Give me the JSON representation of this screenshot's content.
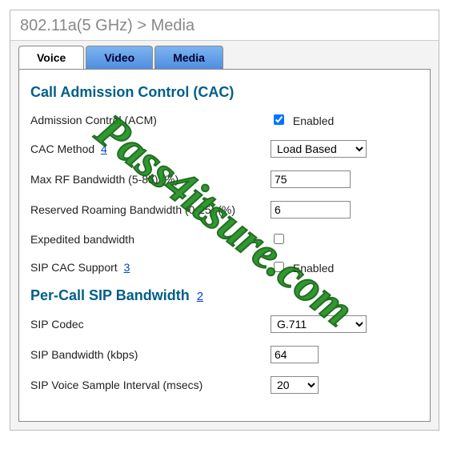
{
  "breadcrumb": "802.11a(5 GHz) > Media",
  "tabs": {
    "voice": "Voice",
    "video": "Video",
    "media": "Media"
  },
  "cac": {
    "heading": "Call Admission Control (CAC)",
    "acm_label": "Admission Control (ACM)",
    "acm_enabled_text": "Enabled",
    "acm_checked": true,
    "method_label": "CAC Method",
    "method_help": "4",
    "method_value": "Load Based",
    "maxrf_label": "Max RF Bandwidth (5-85) (%)",
    "maxrf_value": "75",
    "roaming_label": "Reserved Roaming Bandwidth (0-25) (%)",
    "roaming_value": "6",
    "expedited_label": "Expedited bandwidth",
    "expedited_checked": false,
    "sipcac_label": "SIP CAC Support",
    "sipcac_help": "3",
    "sipcac_enabled_text": "Enabled",
    "sipcac_checked": false
  },
  "percall": {
    "heading": "Per-Call SIP Bandwidth",
    "heading_help": "2",
    "codec_label": "SIP Codec",
    "codec_value": "G.711",
    "bw_label": "SIP Bandwidth (kbps)",
    "bw_value": "64",
    "interval_label": "SIP Voice Sample Interval (msecs)",
    "interval_value": "20"
  },
  "watermark": "Pass4itsure.com"
}
